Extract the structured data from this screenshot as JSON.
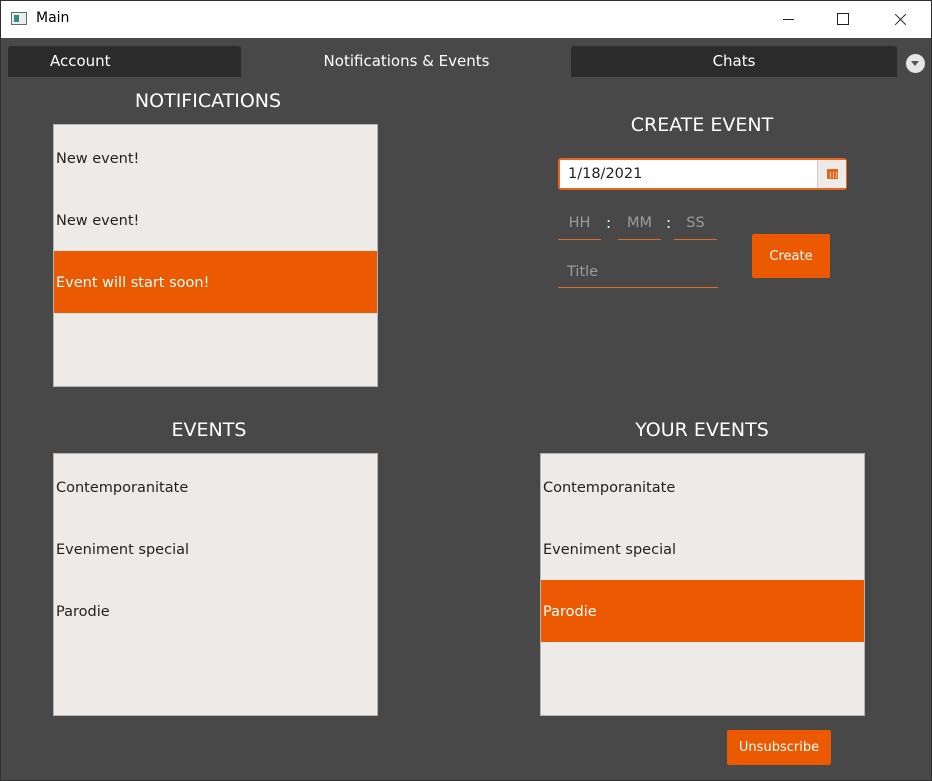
{
  "window": {
    "title": "Main"
  },
  "tabs": [
    {
      "label": "Account"
    },
    {
      "label": "Notifications & Events"
    },
    {
      "label": "Chats"
    }
  ],
  "notifications": {
    "heading": "NOTIFICATIONS",
    "items": [
      {
        "label": "New event!",
        "selected": false
      },
      {
        "label": "New event!",
        "selected": false
      },
      {
        "label": "Event will start soon!",
        "selected": true
      }
    ]
  },
  "create_event": {
    "heading": "CREATE EVENT",
    "date_value": "1/18/2021",
    "hour_placeholder": "HH",
    "minute_placeholder": "MM",
    "second_placeholder": "SS",
    "time_separator": ":",
    "title_placeholder": "Title",
    "create_label": "Create"
  },
  "events": {
    "heading": "EVENTS",
    "items": [
      {
        "label": "Contemporanitate",
        "selected": false
      },
      {
        "label": "Eveniment special",
        "selected": false
      },
      {
        "label": "Parodie",
        "selected": false
      }
    ]
  },
  "your_events": {
    "heading": "YOUR EVENTS",
    "items": [
      {
        "label": "Contemporanitate",
        "selected": false
      },
      {
        "label": "Eveniment special",
        "selected": false
      },
      {
        "label": "Parodie",
        "selected": true
      }
    ],
    "unsubscribe_label": "Unsubscribe"
  },
  "colors": {
    "accent": "#eb5a00",
    "background": "#484848",
    "list_background": "#eeeae8",
    "tab_inactive": "#2b2b2b"
  },
  "icons": [
    "app-icon",
    "minimize-icon",
    "maximize-icon",
    "close-icon",
    "tab-menu-dropdown-icon",
    "calendar-icon"
  ]
}
